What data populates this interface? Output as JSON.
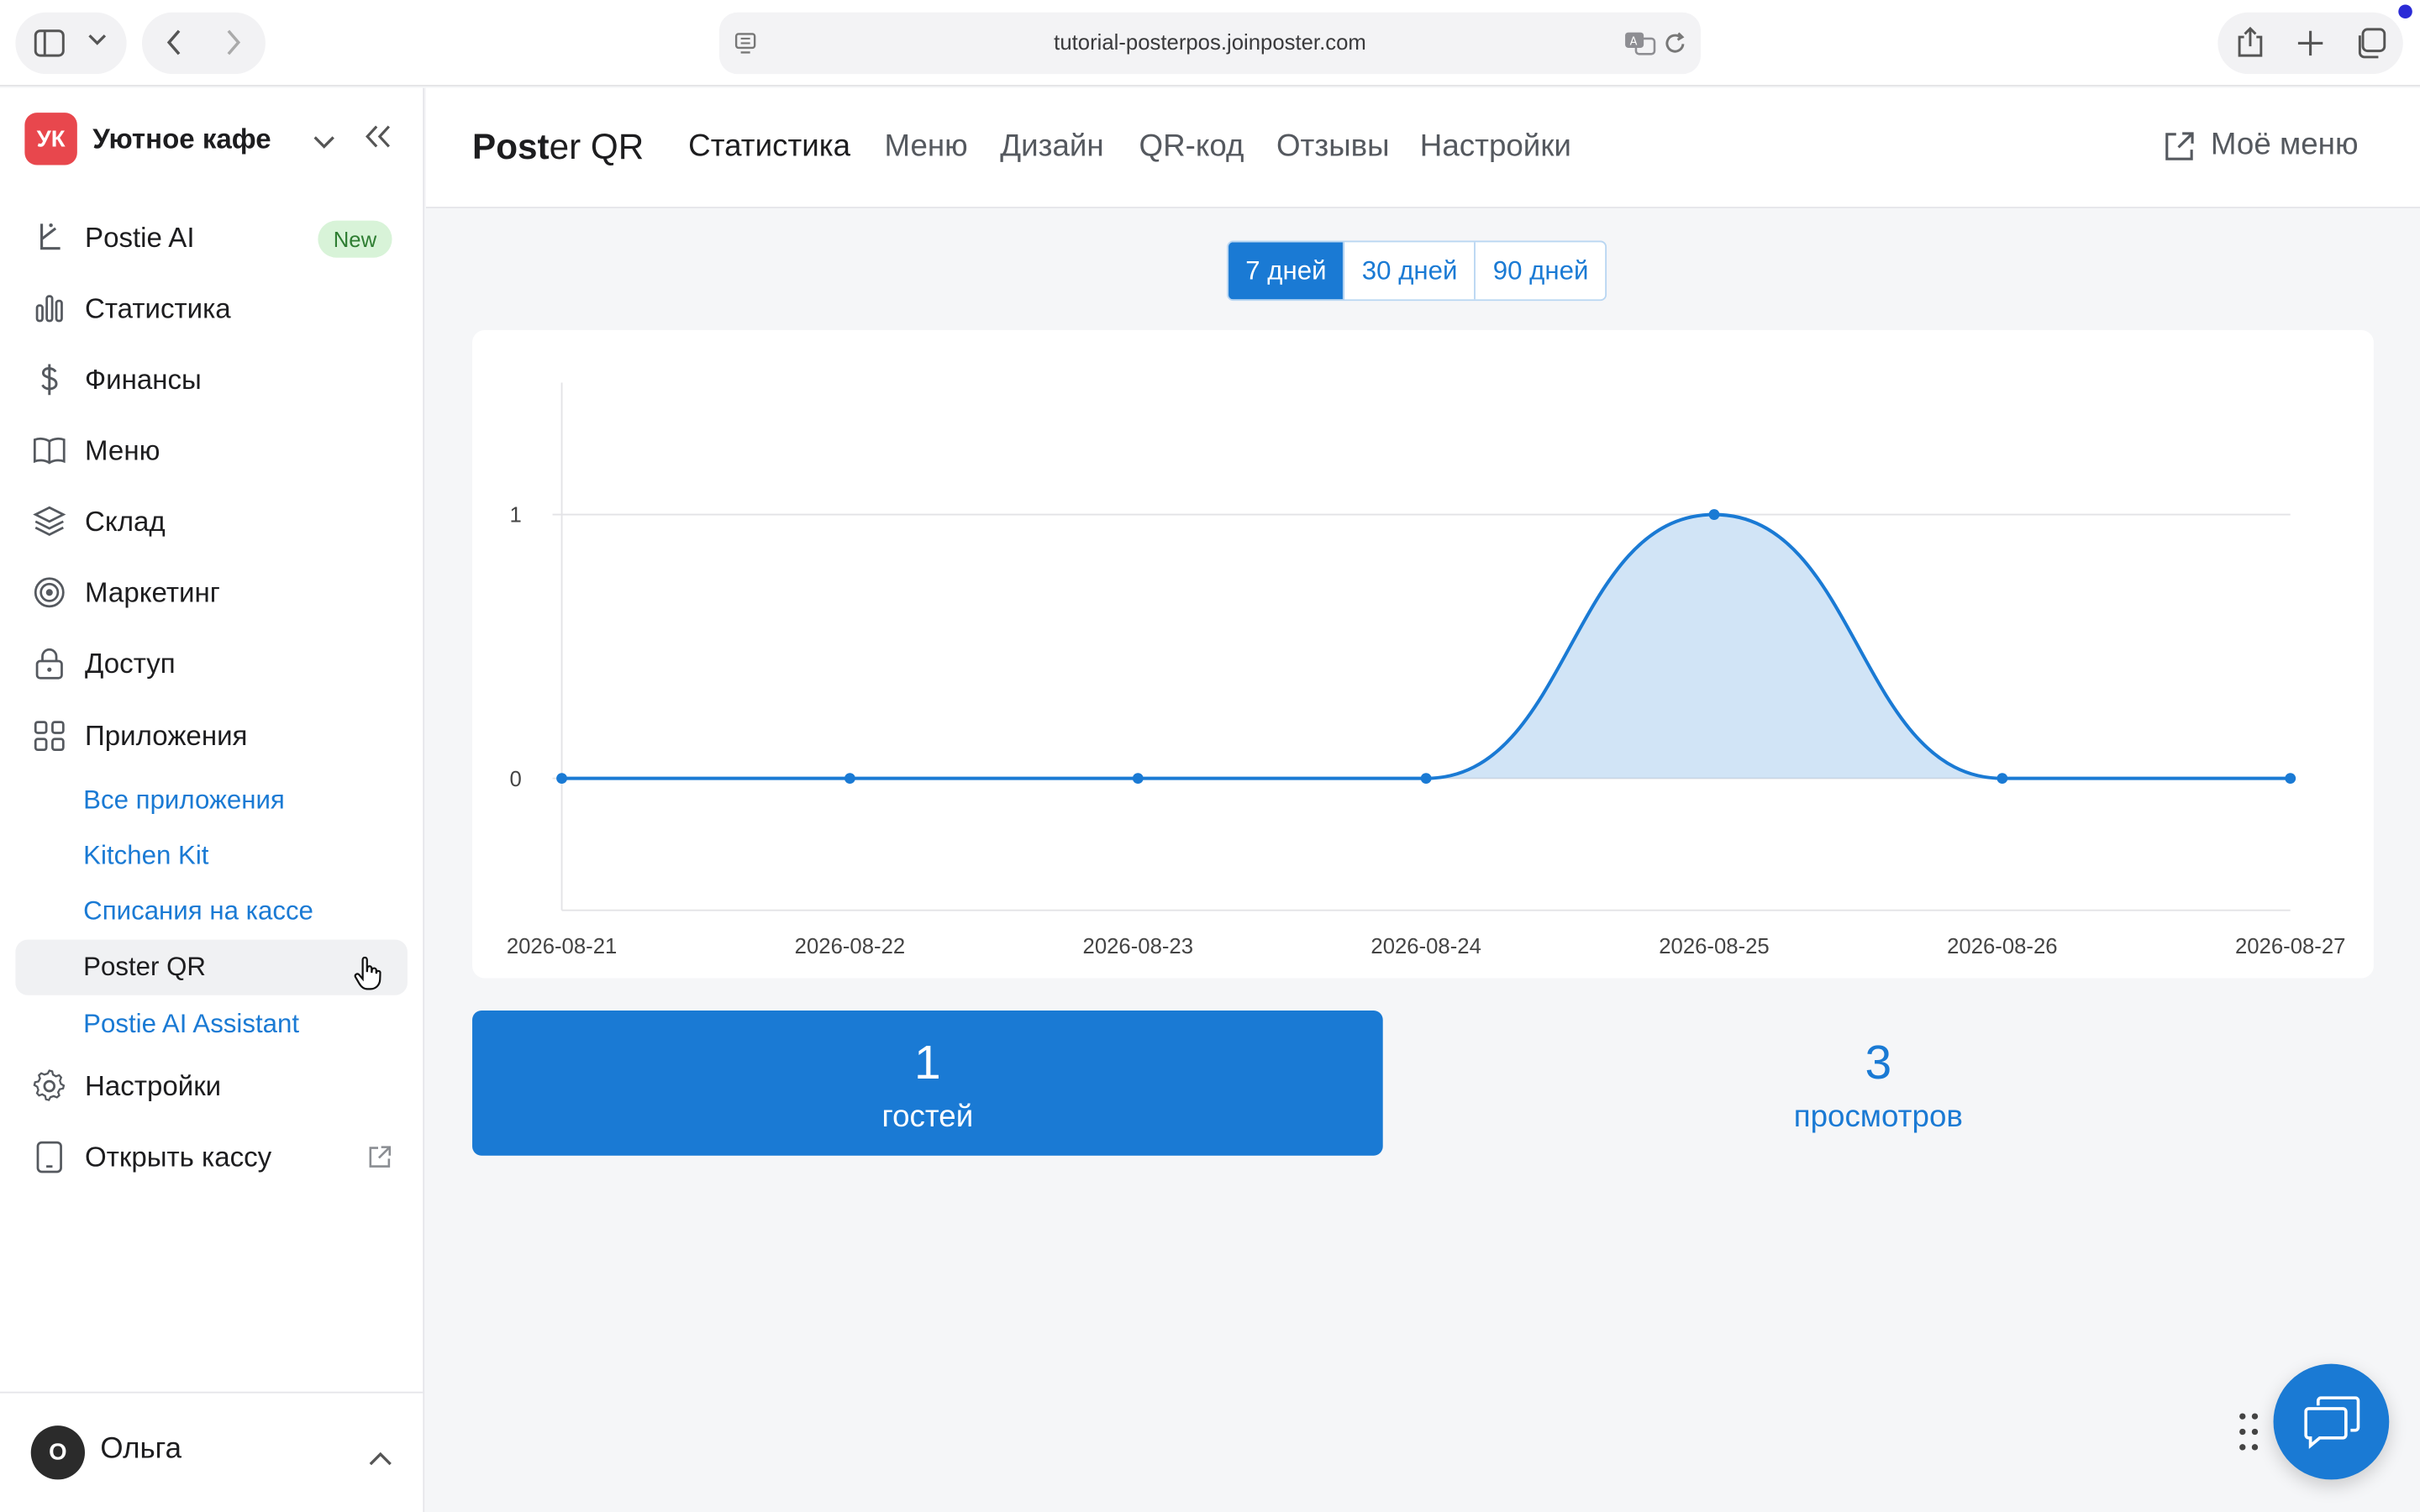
{
  "browser": {
    "url": "tutorial-posterpos.joinposter.com"
  },
  "sidebar": {
    "brand_initials": "УК",
    "brand_name": "Уютное кафе",
    "items": [
      {
        "label": "Postie AI",
        "badge": "New",
        "icon": "postie-icon"
      },
      {
        "label": "Статистика",
        "icon": "bar-chart-icon"
      },
      {
        "label": "Финансы",
        "icon": "dollar-icon"
      },
      {
        "label": "Меню",
        "icon": "book-icon"
      },
      {
        "label": "Склад",
        "icon": "layers-icon"
      },
      {
        "label": "Маркетинг",
        "icon": "target-icon"
      },
      {
        "label": "Доступ",
        "icon": "lock-icon"
      },
      {
        "label": "Приложения",
        "icon": "grid-icon"
      }
    ],
    "app_items": [
      {
        "label": "Все приложения",
        "active": false
      },
      {
        "label": "Kitchen Kit",
        "active": false
      },
      {
        "label": "Списания на кассе",
        "active": false
      },
      {
        "label": "Poster QR",
        "active": true
      },
      {
        "label": "Postie AI Assistant",
        "active": false
      }
    ],
    "bottom_items": [
      {
        "label": "Настройки",
        "icon": "gear-icon"
      },
      {
        "label": "Открыть кассу",
        "icon": "tablet-icon"
      }
    ],
    "user": {
      "initial": "О",
      "name": "Ольга"
    }
  },
  "header": {
    "title_bold": "Post",
    "title_rest": "er QR",
    "tabs": [
      {
        "label": "Статистика",
        "active": true
      },
      {
        "label": "Меню",
        "active": false
      },
      {
        "label": "Дизайн",
        "active": false
      },
      {
        "label": "QR-код",
        "active": false
      },
      {
        "label": "Отзывы",
        "active": false
      },
      {
        "label": "Настройки",
        "active": false
      }
    ],
    "my_menu": "Моё меню"
  },
  "range": {
    "options": [
      "7 дней",
      "30 дней",
      "90 дней"
    ],
    "selected": "7 дней"
  },
  "chart_data": {
    "type": "area",
    "x": [
      "2026-08-21",
      "2026-08-22",
      "2026-08-23",
      "2026-08-24",
      "2026-08-25",
      "2026-08-26",
      "2026-08-27"
    ],
    "series": [
      {
        "values": [
          0,
          0,
          0,
          0,
          1,
          0,
          0
        ],
        "color": "#1a7ad4"
      }
    ],
    "y_ticks": [
      0,
      1
    ],
    "ylim": [
      -0.5,
      1.5
    ],
    "grid": true,
    "title": "",
    "xlabel": "",
    "ylabel": ""
  },
  "stats": [
    {
      "value": "1",
      "label": "гостей",
      "highlighted": true
    },
    {
      "value": "3",
      "label": "просмотров",
      "highlighted": false
    }
  ],
  "colors": {
    "accent": "#1a7ad4",
    "brand_logo": "#e8474d",
    "badge_bg": "#d8f3d8"
  }
}
